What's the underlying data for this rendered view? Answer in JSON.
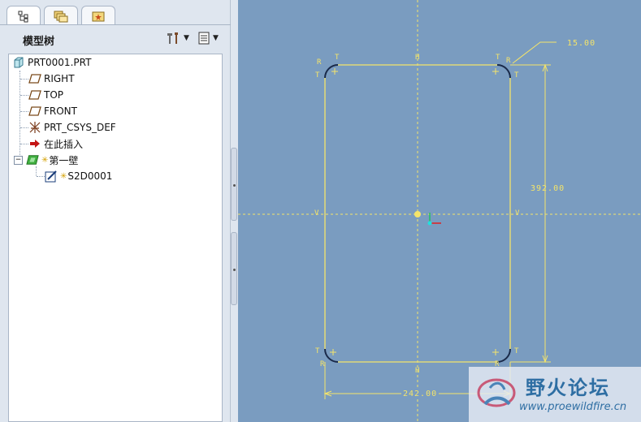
{
  "tabs": [
    {
      "name": "model-tree-tab",
      "icon": "tree-icon"
    },
    {
      "name": "folder-browser-tab",
      "icon": "folders-icon"
    },
    {
      "name": "favorites-tab",
      "icon": "star-folder-icon"
    }
  ],
  "panel": {
    "title": "模型树",
    "settings_icon": "tools-icon",
    "show_icon": "list-icon"
  },
  "tree": {
    "items": [
      {
        "label": "PRT0001.PRT",
        "icon": "part-icon"
      },
      {
        "label": "RIGHT",
        "icon": "datum-plane-icon"
      },
      {
        "label": "TOP",
        "icon": "datum-plane-icon"
      },
      {
        "label": "FRONT",
        "icon": "datum-plane-icon"
      },
      {
        "label": "PRT_CSYS_DEF",
        "icon": "csys-icon"
      },
      {
        "label": "在此插入",
        "icon": "insert-arrow-icon"
      },
      {
        "label": "第一壁",
        "icon": "wall-feature-icon",
        "expanded": true
      },
      {
        "label": "S2D0001",
        "icon": "sketch-icon"
      }
    ]
  },
  "sketch": {
    "dim_top": "15.00",
    "dim_right": "392.00",
    "dim_bottom": "242.00",
    "constraint_labels": [
      "R",
      "T",
      "H",
      "V"
    ]
  },
  "watermark": {
    "title": "野火论坛",
    "url": "www.proewildfire.cn"
  },
  "colors": {
    "canvas_bg": "#7a9cc0",
    "sketch_line": "#f4e46a",
    "panel_bg": "#dfe6ef"
  }
}
